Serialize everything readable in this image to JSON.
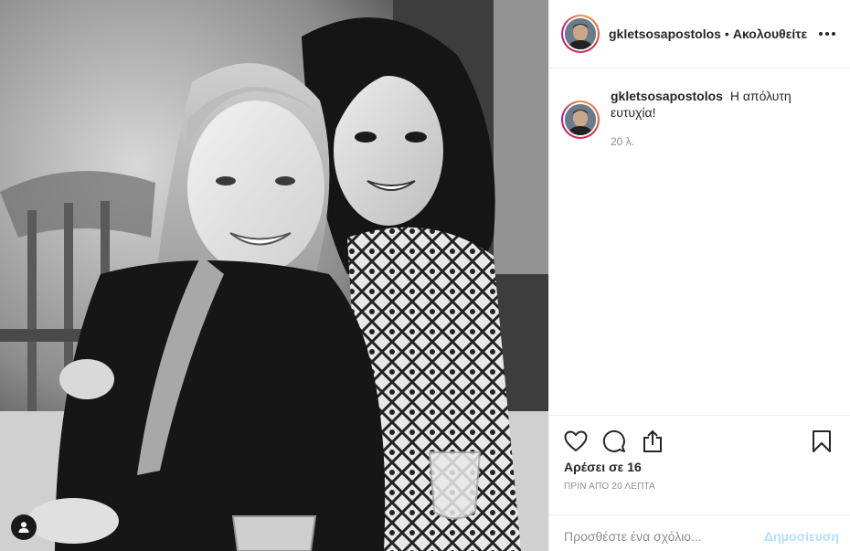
{
  "post": {
    "image_alt": "Black and white photo of two smiling women",
    "user_tags_icon": "user-silhouette-icon"
  },
  "header": {
    "username": "gkletsosapostolos",
    "separator": "•",
    "follow_label": "Ακολουθείτε",
    "more_icon": "more-horizontal-icon"
  },
  "caption": {
    "username": "gkletsosapostolos",
    "text": "Η απόλυτη ευτυχία!",
    "time": "20 λ."
  },
  "actions": {
    "like_icon": "heart-icon",
    "comment_icon": "comment-icon",
    "share_icon": "share-icon",
    "save_icon": "bookmark-icon",
    "likes_text": "Αρέσει σε 16",
    "timestamp": "ΠΡΙΝ ΑΠΟ 20 ΛΕΠΤΑ"
  },
  "comment_box": {
    "placeholder": "Προσθέστε ένα σχόλιο...",
    "post_label": "Δημοσίευση"
  }
}
